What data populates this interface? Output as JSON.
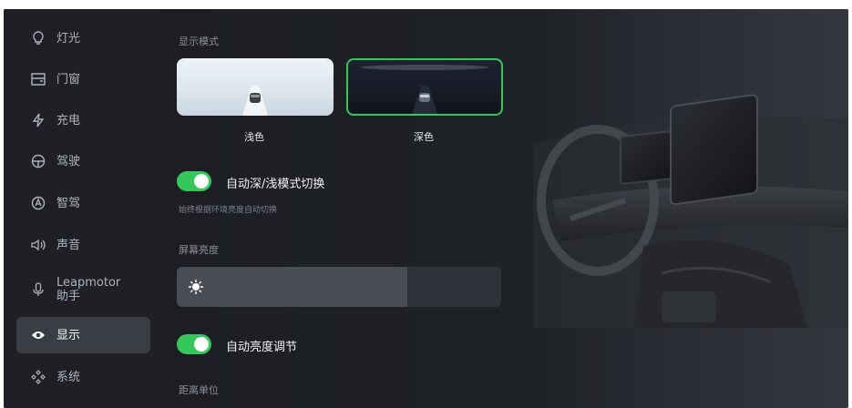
{
  "sidebar": {
    "items": [
      {
        "label": "灯光",
        "icon": "lightbulb-icon"
      },
      {
        "label": "门窗",
        "icon": "door-icon"
      },
      {
        "label": "充电",
        "icon": "lightning-icon"
      },
      {
        "label": "驾驶",
        "icon": "steering-wheel-icon"
      },
      {
        "label": "智驾",
        "icon": "smart-drive-icon"
      },
      {
        "label": "声音",
        "icon": "speaker-icon"
      },
      {
        "label": "Leapmotor",
        "label2": "助手",
        "icon": "microphone-icon"
      },
      {
        "label": "显示",
        "icon": "eye-icon",
        "active": true
      },
      {
        "label": "系统",
        "icon": "system-icon"
      }
    ]
  },
  "display": {
    "mode_title": "显示模式",
    "modes": [
      {
        "label": "浅色",
        "selected": false
      },
      {
        "label": "深色",
        "selected": true
      }
    ],
    "auto_mode_label": "自动深/浅模式切换",
    "auto_mode_enabled": true,
    "auto_mode_hint": "始终根据环境亮度自动切换",
    "brightness_title": "屏幕亮度",
    "brightness_level": 0.71,
    "auto_brightness_label": "自动亮度调节",
    "auto_brightness_enabled": true,
    "distance_unit_title": "距离单位"
  },
  "colors": {
    "accent": "#34c759",
    "background": "#1b1d22",
    "active_nav": "#3a3d44"
  }
}
